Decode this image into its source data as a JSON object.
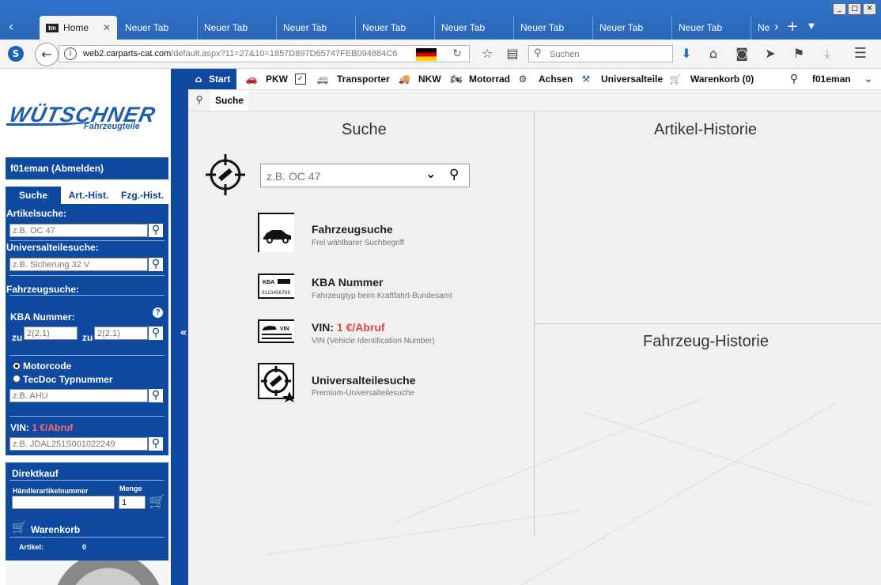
{
  "browser": {
    "window_buttons": [
      "_",
      "□",
      "✕"
    ],
    "tabs": [
      {
        "label": "Home",
        "active": true
      },
      {
        "label": "Neuer Tab"
      },
      {
        "label": "Neuer Tab"
      },
      {
        "label": "Neuer Tab"
      },
      {
        "label": "Neuer Tab"
      },
      {
        "label": "Neuer Tab"
      },
      {
        "label": "Neuer Tab"
      },
      {
        "label": "Neuer Tab"
      },
      {
        "label": "Neuer Tab"
      },
      {
        "label": "Ne"
      }
    ],
    "tab_favicon": "tm",
    "url_host": "web2.carparts-cat.com",
    "url_path": "/default.aspx?11=27&10=1857D897D65747FEB094884C6",
    "search_placeholder": "Suchen",
    "icons": [
      "back-icon",
      "info-icon",
      "reload-icon",
      "star-icon",
      "reader-icon",
      "download-icon",
      "home-icon",
      "pocket-icon",
      "send-icon",
      "flag-icon",
      "downloads-icon",
      "menu-icon"
    ]
  },
  "sidebar": {
    "logo_text": "WÜTSCHNER",
    "logo_sub": "Fahrzeugteile",
    "user": "f01eman",
    "logout": "(Abmelden)",
    "tabs": [
      "Suche",
      "Art.-Hist.",
      "Fzg.-Hist."
    ],
    "artikelsuche_label": "Artikelsuche:",
    "artikelsuche_placeholder": "z.B. OC 47",
    "universal_label": "Universalteilesuche:",
    "universal_placeholder": "z.B. Sicherung 32 V",
    "fahrzeugsuche_label": "Fahrzeugsuche:",
    "kba_label": "KBA Nummer:",
    "zu": "zu",
    "kba_placeholder_1": "2(2.1)",
    "kba_placeholder_2": "2(2.1)",
    "radio_motorcode": "Motorcode",
    "radio_tecdoc": "TecDoc Typnummer",
    "motor_placeholder": "z.B. AHU",
    "vin_label": "VIN:",
    "vin_price": "1 €/Abruf",
    "vin_placeholder": "z.B. JDAL251S001022249",
    "direktkauf_title": "Direktkauf",
    "haendler_label": "Händlerartikelnummer",
    "menge_label": "Menge",
    "menge_value": "1",
    "warenkorb_title": "Warenkorb",
    "artikel_label": "Artikel:",
    "artikel_count": "0"
  },
  "appmenu": {
    "items": [
      "Start",
      "PKW",
      "Transporter",
      "NKW",
      "Motorrad",
      "Achsen",
      "Universalteile",
      "Warenkorb (0)"
    ],
    "user": "f01eman",
    "sub_tab": "Suche"
  },
  "main": {
    "suche_title": "Suche",
    "search_placeholder": "z.B. OC 47",
    "categories": [
      {
        "title": "Fahrzeugsuche",
        "sub": "Frei wählbarer Suchbegriff"
      },
      {
        "title": "KBA Nummer",
        "sub": "Fahrzeugtyp beim Kraftfahrt-Bundesamt"
      },
      {
        "title": "VIN:",
        "price": "1 €/Abruf",
        "sub": "VIN (Vehicle Identification Number)"
      },
      {
        "title": "Universalteilesuche",
        "sub": "Premium-Universalteilesuche"
      }
    ],
    "artikel_historie": "Artikel-Historie",
    "fahrzeug_historie": "Fahrzeug-Historie",
    "kba_icon_text": "KBA",
    "kba_icon_digits": "0123456789",
    "vin_icon_text": "VIN"
  }
}
